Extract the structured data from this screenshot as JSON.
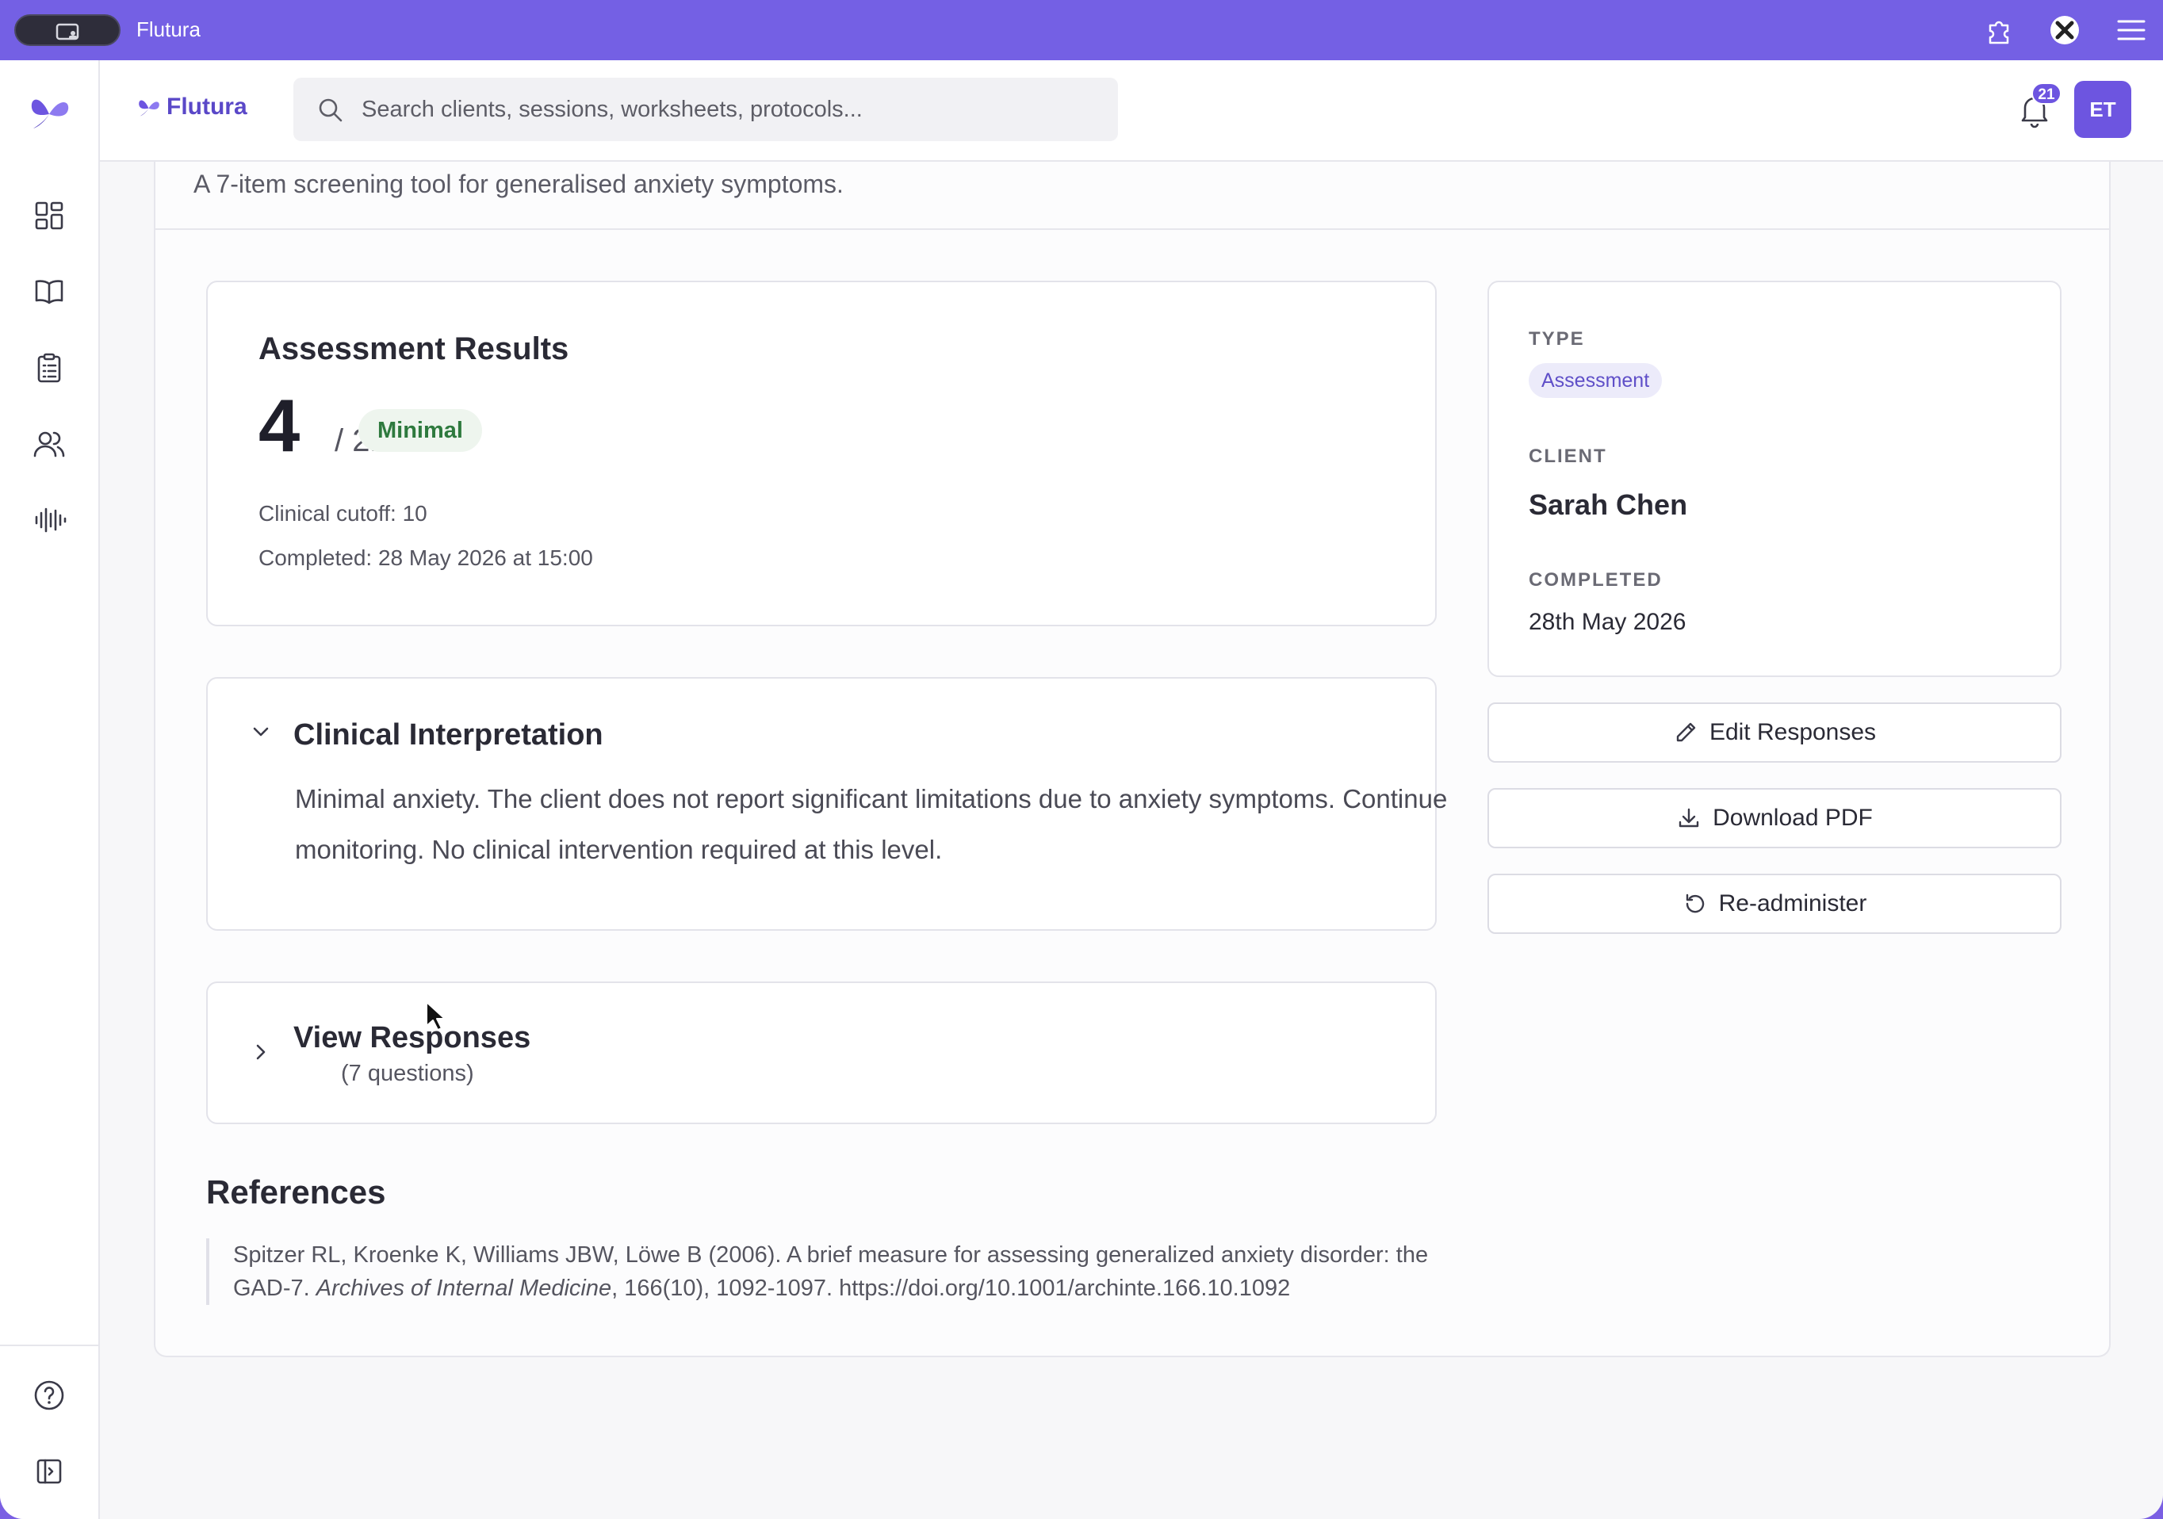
{
  "window": {
    "title": "Flutura"
  },
  "header": {
    "brand": "Flutura",
    "search_placeholder": "Search clients, sessions, worksheets, protocols...",
    "notification_count": "21",
    "avatar_initials": "ET"
  },
  "sidebar": {
    "items": [
      {
        "icon": "dashboard-icon"
      },
      {
        "icon": "book-icon"
      },
      {
        "icon": "clipboard-icon"
      },
      {
        "icon": "users-icon"
      },
      {
        "icon": "audio-waveform-icon"
      }
    ],
    "bottom": [
      {
        "icon": "help-circle-icon"
      },
      {
        "icon": "sidebar-expand-icon"
      }
    ]
  },
  "page": {
    "description": "A 7-item screening tool for generalised anxiety symptoms."
  },
  "results": {
    "title": "Assessment Results",
    "score": "4",
    "max": "/ 21",
    "severity": "Minimal",
    "cutoff": "Clinical cutoff: 10",
    "completed": "Completed: 28 May 2026 at 15:00"
  },
  "interpretation": {
    "title": "Clinical Interpretation",
    "text": "Minimal anxiety. The client does not report significant limitations due to anxiety symptoms. Continue monitoring. No clinical intervention required at this level."
  },
  "responses": {
    "title": "View Responses",
    "count": "(7 questions)"
  },
  "references": {
    "title": "References",
    "line_pre": "Spitzer RL, Kroenke K, Williams JBW, Löwe B (2006). A brief measure for assessing generalized anxiety disorder: the GAD-7. ",
    "journal": "Archives of Internal Medicine",
    "line_post": ", 166(10), 1092-1097. https://doi.org/10.1001/archinte.166.10.1092"
  },
  "details": {
    "type_label": "TYPE",
    "type_value": "Assessment",
    "client_label": "CLIENT",
    "client_name": "Sarah Chen",
    "completed_label": "COMPLETED",
    "completed_date": "28th May 2026"
  },
  "actions": {
    "edit": "Edit Responses",
    "download": "Download PDF",
    "readminister": "Re-administer"
  },
  "colors": {
    "accent": "#6d55e0",
    "titlebar": "#7460e4",
    "severity_bg": "#eef5ee",
    "severity_text": "#2e7a3e"
  }
}
